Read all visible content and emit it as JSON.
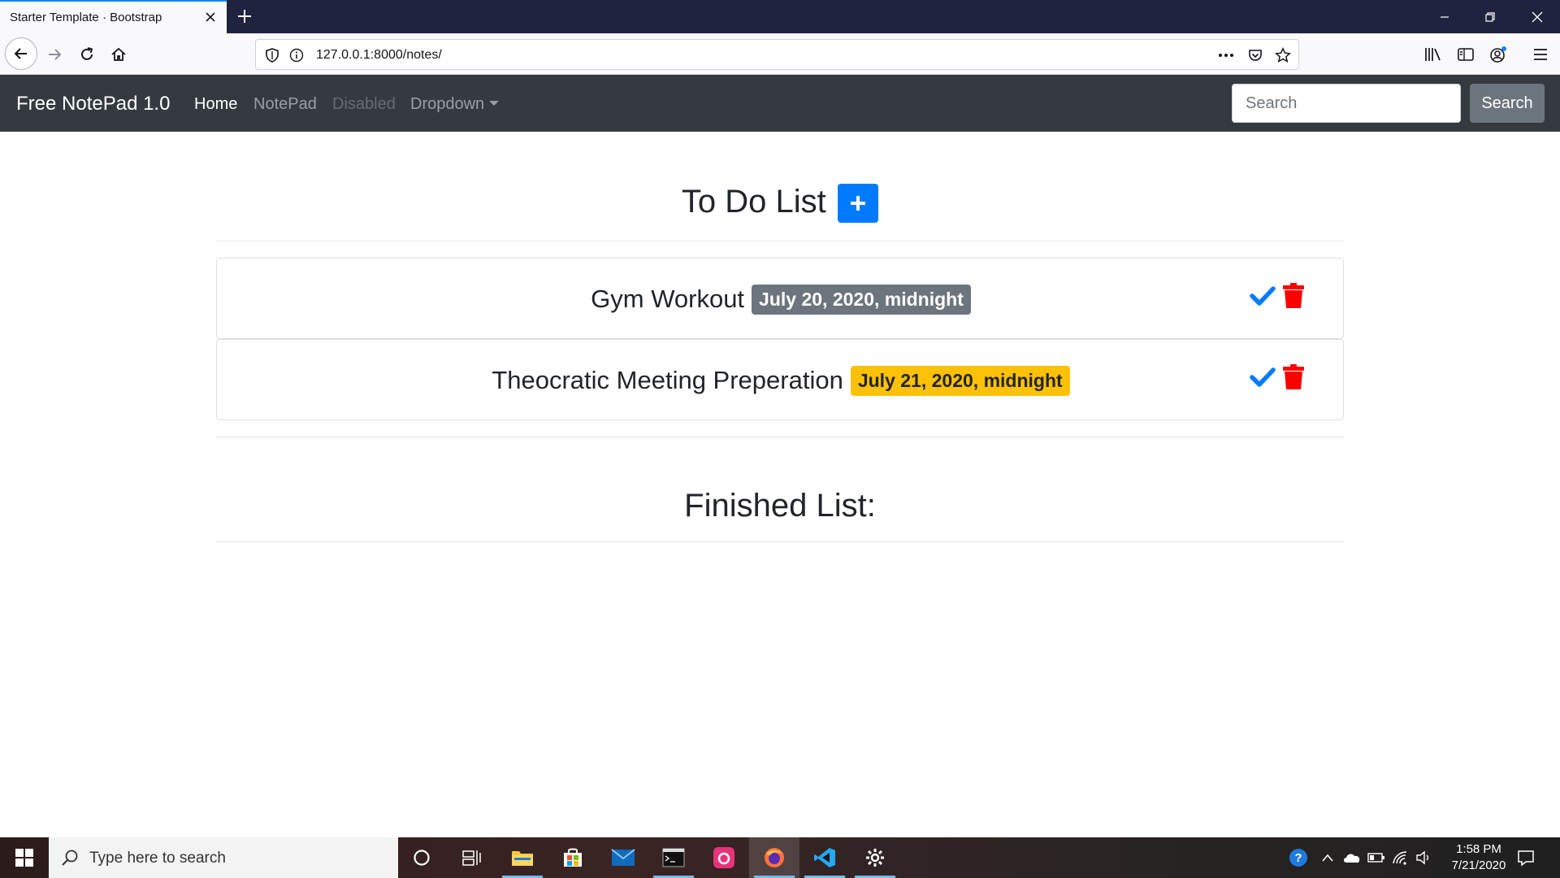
{
  "browser": {
    "tab_title": "Starter Template · Bootstrap",
    "url": "127.0.0.1:8000/notes/"
  },
  "navbar": {
    "brand": "Free NotePad 1.0",
    "links": [
      "Home",
      "NotePad",
      "Disabled",
      "Dropdown"
    ],
    "search_placeholder": "Search",
    "search_button": "Search"
  },
  "todo": {
    "title": "To Do List",
    "items": [
      {
        "title": "Gym Workout",
        "date": "July 20, 2020, midnight",
        "badge_color": "#6c757d"
      },
      {
        "title": "Theocratic Meeting Preperation",
        "date": "July 21, 2020, midnight",
        "badge_color": "#ffc107"
      }
    ]
  },
  "finished": {
    "title": "Finished List:"
  },
  "taskbar": {
    "search_placeholder": "Type here to search",
    "time": "1:58 PM",
    "date": "7/21/2020"
  },
  "colors": {
    "primary": "#007bff",
    "danger": "#ff0000",
    "navbar": "#343a40"
  }
}
